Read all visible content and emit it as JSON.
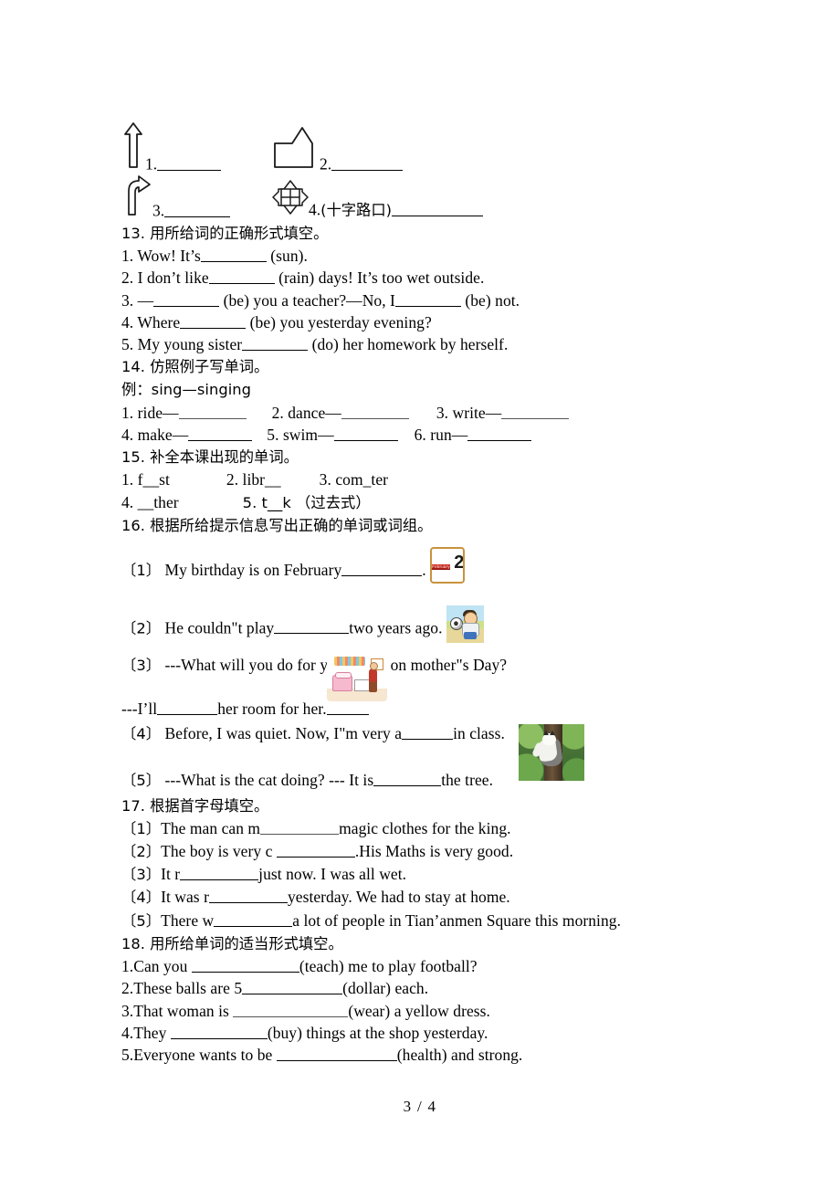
{
  "page": {
    "footer": "3 / 4"
  },
  "direction_icons": {
    "items": [
      {
        "number": "1.",
        "icon": "up-arrow-icon",
        "note": ""
      },
      {
        "number": "2.",
        "icon": "building-house-icon",
        "note": ""
      },
      {
        "number": "3.",
        "icon": "turn-right-arrow-icon",
        "note": ""
      },
      {
        "number": "4.",
        "icon": "crossroads-icon",
        "note": "(十字路口)"
      }
    ]
  },
  "section13": {
    "heading": "13. 用所给词的正确形式填空。",
    "items": [
      {
        "pre": "1. Wow! It’s",
        "post": " (sun)."
      },
      {
        "pre": "2. I don’t like",
        "post": " (rain) days! It’s too wet outside."
      },
      {
        "pre": "3. —",
        "mid": " (be) you a teacher?—No, I",
        "post": " (be) not."
      },
      {
        "pre": "4. Where",
        "post": " (be) you yesterday evening?"
      },
      {
        "pre": "5. My young sister",
        "post": " (do) her homework by herself."
      }
    ]
  },
  "section14": {
    "heading": "14. 仿照例子写单词。",
    "example": "例：sing—singing",
    "words_row1": [
      {
        "label": "1. ride—"
      },
      {
        "label": "2. dance—"
      },
      {
        "label": "3. write—"
      }
    ],
    "words_row2": [
      {
        "label": "4. make—"
      },
      {
        "label": "5. swim—"
      },
      {
        "label": "6. run—"
      }
    ]
  },
  "section15": {
    "heading": "15. 补全本课出现的单词。",
    "row1": [
      "1. f__st",
      "2. libr__",
      "3. com_ter"
    ],
    "row2": [
      "4. __ther",
      "5. t__k （过去式）"
    ]
  },
  "section16": {
    "heading": "16. 根据所给提示信息写出正确的单词或词组。",
    "q1": {
      "num": "〔1〕",
      "pre": "My birthday is on February",
      "post": ".",
      "image": "calendar-february-2-icon"
    },
    "calendar": {
      "month": "February",
      "day": "2"
    },
    "q2": {
      "num": "〔2〕",
      "pre": "He couldn\"t play",
      "post": "two years ago.",
      "image": "boy-playing-soccer-image"
    },
    "q3": {
      "num": "〔3〕",
      "text": "---What will you do for your mum on mother\"s Day?"
    },
    "q3b": {
      "pre": "---I’ll",
      "post": "her room for her.",
      "image": "tidy-room-clipart"
    },
    "q4": {
      "num": "〔4〕",
      "pre": "Before, I was quiet. Now, I\"m very a",
      "post": "in class."
    },
    "q5": {
      "num": "〔5〕",
      "pre": "---What is the cat doing? --- It is",
      "post": "the tree.",
      "image": "cat-climbing-tree-photo"
    }
  },
  "section17": {
    "heading": "17. 根据首字母填空。",
    "items": [
      {
        "num": "〔1〕",
        "pre": "The man can m",
        "post": "magic clothes for the king."
      },
      {
        "num": "〔2〕",
        "pre": "The boy is very c ",
        "post": ".His Maths is very good."
      },
      {
        "num": "〔3〕",
        "pre": "It r",
        "post": "just now. I was all wet."
      },
      {
        "num": "〔4〕",
        "pre": "It was r",
        "post": "yesterday. We had to stay at home."
      },
      {
        "num": "〔5〕",
        "pre": "There w",
        "post": "a lot of people in Tian’anmen Square this morning."
      }
    ]
  },
  "section18": {
    "heading": "18. 用所给单词的适当形式填空。",
    "items": [
      {
        "pre": "1.Can you ",
        "post": "(teach) me to play football?"
      },
      {
        "pre": "2.These balls are 5",
        "post": "(dollar) each."
      },
      {
        "pre": "3.That woman is ",
        "post": "(wear) a yellow dress."
      },
      {
        "pre": "4.They ",
        "post": "(buy) things at the shop yesterday."
      },
      {
        "pre": "5.Everyone wants to be ",
        "post": "(health) and strong."
      }
    ]
  }
}
